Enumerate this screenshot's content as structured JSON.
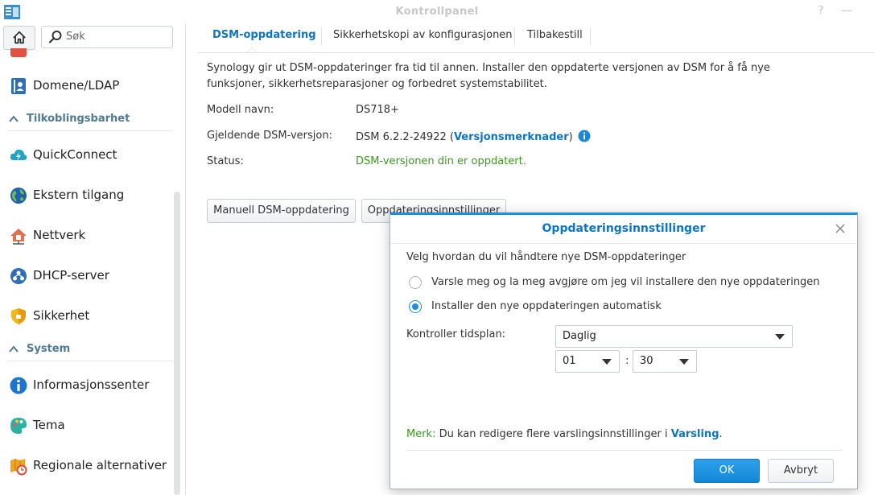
{
  "window": {
    "title": "Kontrollpanel",
    "help_glyph": "?",
    "minimize_glyph": "—"
  },
  "sidebar": {
    "search": {
      "placeholder": "Søk"
    },
    "items": [
      {
        "label": "Domene/LDAP",
        "icon": "directory-icon"
      },
      {
        "label": "QuickConnect",
        "icon": "quickconnect-icon"
      },
      {
        "label": "Ekstern tilgang",
        "icon": "globe-icon"
      },
      {
        "label": "Nettverk",
        "icon": "network-icon"
      },
      {
        "label": "DHCP-server",
        "icon": "dhcp-icon"
      },
      {
        "label": "Sikkerhet",
        "icon": "shield-icon"
      },
      {
        "label": "Informasjonssenter",
        "icon": "info-icon"
      },
      {
        "label": "Tema",
        "icon": "palette-icon"
      },
      {
        "label": "Regionale alternativer",
        "icon": "regional-options-icon"
      }
    ],
    "sections": [
      {
        "label": "Tilkoblingsbarhet"
      },
      {
        "label": "System"
      }
    ]
  },
  "tabs": [
    {
      "label": "DSM-oppdatering",
      "active": true
    },
    {
      "label": "Sikkerhetskopi av konfigurasjonen",
      "active": false
    },
    {
      "label": "Tilbakestill",
      "active": false
    }
  ],
  "main": {
    "description": "Synology gir ut DSM-oppdateringer fra tid til annen. Installer den oppdaterte versjonen av DSM for å få nye funksjoner, sikkerhetsreparasjoner og forbedret systemstabilitet.",
    "fields": {
      "model_label": "Modell navn:",
      "model_value": "DS718+",
      "version_label": "Gjeldende DSM-versjon:",
      "version_value": "DSM 6.2.2-24922 (",
      "version_link": "Versjonsmerknader",
      "version_close": ")",
      "status_label": "Status:",
      "status_value": "DSM-versjonen din er oppdatert."
    },
    "buttons": {
      "manual_update": "Manuell DSM-oppdatering",
      "update_settings": "Oppdateringsinnstillinger"
    }
  },
  "dialog": {
    "title": "Oppdateringsinnstillinger",
    "prompt": "Velg hvordan du vil håndtere nye DSM-oppdateringer",
    "options": [
      {
        "label": "Varsle meg og la meg avgjøre om jeg vil installere den nye oppdateringen",
        "selected": false
      },
      {
        "label": "Installer den nye oppdateringen automatisk",
        "selected": true
      }
    ],
    "schedule_label": "Kontroller tidsplan:",
    "schedule_value": "Daglig",
    "hour_value": "01",
    "time_separator": ":",
    "minute_value": "30",
    "note_lead": "Merk:",
    "note_text": " Du kan redigere flere varslingsinnstillinger i ",
    "note_link": "Varsling",
    "note_end": ".",
    "ok_label": "OK",
    "cancel_label": "Avbryt"
  },
  "colors": {
    "accent": "#0e75c4",
    "success": "#3a9a1e",
    "dialog_border": "#1b8fdb"
  }
}
